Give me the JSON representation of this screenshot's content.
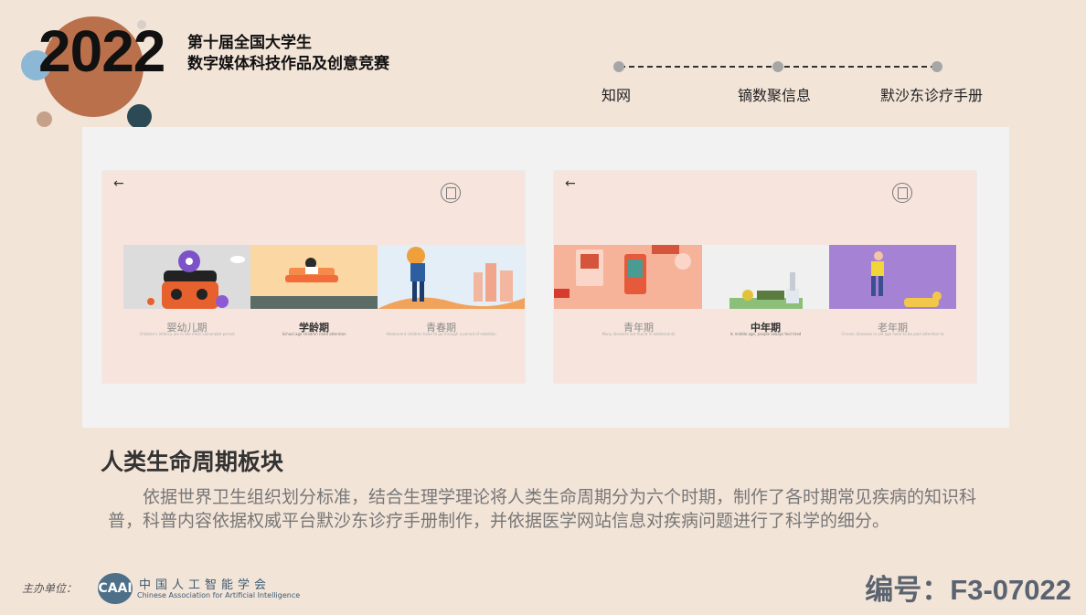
{
  "header": {
    "year": "2022",
    "competition_line1": "第十届全国大学生",
    "competition_line2": "数字媒体科技作品及创意竞赛"
  },
  "progress": {
    "steps": [
      "知网",
      "镝数聚信息",
      "默沙东诊疗手册"
    ]
  },
  "screens": [
    {
      "back": "←",
      "items": [
        {
          "label": "婴幼儿期",
          "sub": "Children's infancy are in the most vulnerable period"
        },
        {
          "label": "学龄期",
          "sub": "School age children need attention"
        },
        {
          "label": "青春期",
          "sub": "Adolescent children have to go through a period of rebellion"
        }
      ]
    },
    {
      "back": "←",
      "items": [
        {
          "label": "青年期",
          "sub": "Many diseases are found in adolescents"
        },
        {
          "label": "中年期",
          "sub": "In middle age, people always feel tired"
        },
        {
          "label": "老年期",
          "sub": "Chronic diseases in old age need to be paid attention to"
        }
      ]
    }
  ],
  "section": {
    "title": "人类生命周期板块",
    "description": "依据世界卫生组织划分标准，结合生理学理论将人类生命周期分为六个时期，制作了各时期常见疾病的知识科普，科普内容依据权威平台默沙东诊疗手册制作，并依据医学网站信息对疾病问题进行了科学的细分。"
  },
  "footer": {
    "sponsor_label": "主办单位：",
    "logo_text": "CAAI",
    "org_cn": "中国人工智能学会",
    "org_en": "Chinese Association for Artificial Intelligence",
    "code": "编号：F3-07022"
  }
}
